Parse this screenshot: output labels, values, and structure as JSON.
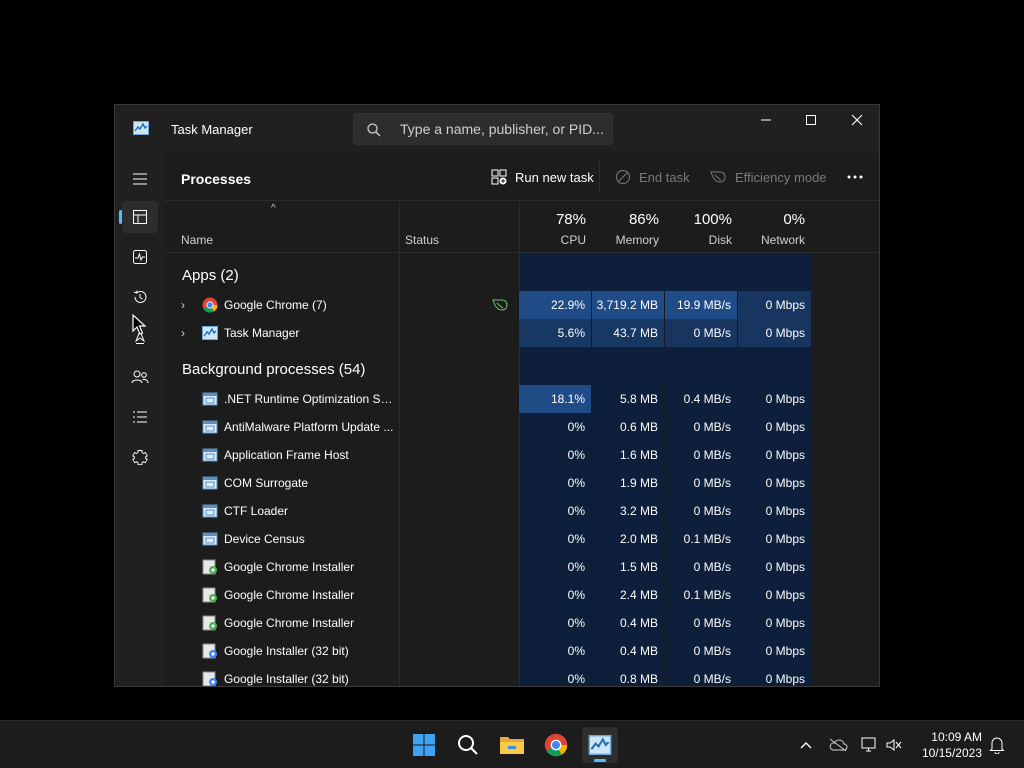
{
  "window": {
    "title": "Task Manager",
    "search_placeholder": "Type a name, publisher, or PID..."
  },
  "toolbar": {
    "page_title": "Processes",
    "run_new_task": "Run new task",
    "end_task": "End task",
    "efficiency_mode": "Efficiency mode"
  },
  "rail": {
    "items": [
      {
        "icon": "hamburger-menu-icon"
      },
      {
        "icon": "processes-icon",
        "active": true
      },
      {
        "icon": "performance-icon"
      },
      {
        "icon": "app-history-icon"
      },
      {
        "icon": "startup-apps-icon"
      },
      {
        "icon": "users-icon"
      },
      {
        "icon": "details-icon"
      },
      {
        "icon": "services-icon"
      },
      {
        "icon": "settings-icon"
      }
    ]
  },
  "columns": {
    "name": "Name",
    "status": "Status",
    "cpu": {
      "pct": "78%",
      "label": "CPU"
    },
    "memory": {
      "pct": "86%",
      "label": "Memory"
    },
    "disk": {
      "pct": "100%",
      "label": "Disk"
    },
    "network": {
      "pct": "0%",
      "label": "Network"
    }
  },
  "groups": {
    "apps": "Apps (2)",
    "background": "Background processes (54)"
  },
  "apps": [
    {
      "name": "Google Chrome (7)",
      "icon": "chrome-icon",
      "efficiency": true,
      "cpu": "22.9%",
      "memory": "3,719.2 MB",
      "disk": "19.9 MB/s",
      "network": "0 Mbps"
    },
    {
      "name": "Task Manager",
      "icon": "task-manager-icon",
      "efficiency": false,
      "cpu": "5.6%",
      "memory": "43.7 MB",
      "disk": "0 MB/s",
      "network": "0 Mbps"
    }
  ],
  "background": [
    {
      "name": ".NET Runtime Optimization Se...",
      "icon": "process-icon",
      "cpu": "18.1%",
      "memory": "5.8 MB",
      "disk": "0.4 MB/s",
      "network": "0 Mbps"
    },
    {
      "name": "AntiMalware Platform Update ...",
      "icon": "process-icon",
      "cpu": "0%",
      "memory": "0.6 MB",
      "disk": "0 MB/s",
      "network": "0 Mbps"
    },
    {
      "name": "Application Frame Host",
      "icon": "process-icon",
      "cpu": "0%",
      "memory": "1.6 MB",
      "disk": "0 MB/s",
      "network": "0 Mbps"
    },
    {
      "name": "COM Surrogate",
      "icon": "process-icon",
      "cpu": "0%",
      "memory": "1.9 MB",
      "disk": "0 MB/s",
      "network": "0 Mbps"
    },
    {
      "name": "CTF Loader",
      "icon": "process-icon",
      "cpu": "0%",
      "memory": "3.2 MB",
      "disk": "0 MB/s",
      "network": "0 Mbps"
    },
    {
      "name": "Device Census",
      "icon": "process-icon",
      "cpu": "0%",
      "memory": "2.0 MB",
      "disk": "0.1 MB/s",
      "network": "0 Mbps"
    },
    {
      "name": "Google Chrome Installer",
      "icon": "installer-icon",
      "cpu": "0%",
      "memory": "1.5 MB",
      "disk": "0 MB/s",
      "network": "0 Mbps"
    },
    {
      "name": "Google Chrome Installer",
      "icon": "installer-icon",
      "cpu": "0%",
      "memory": "2.4 MB",
      "disk": "0.1 MB/s",
      "network": "0 Mbps"
    },
    {
      "name": "Google Chrome Installer",
      "icon": "installer-icon",
      "cpu": "0%",
      "memory": "0.4 MB",
      "disk": "0 MB/s",
      "network": "0 Mbps"
    },
    {
      "name": "Google Installer (32 bit)",
      "icon": "installer-icon",
      "cpu": "0%",
      "memory": "0.4 MB",
      "disk": "0 MB/s",
      "network": "0 Mbps"
    },
    {
      "name": "Google Installer (32 bit)",
      "icon": "installer-icon",
      "cpu": "0%",
      "memory": "0.8 MB",
      "disk": "0 MB/s",
      "network": "0 Mbps"
    }
  ],
  "taskbar": {
    "apps": [
      "start-icon",
      "search-icon",
      "file-explorer-icon",
      "chrome-icon",
      "task-manager-icon"
    ],
    "time": "10:09 AM",
    "date": "10/15/2023"
  },
  "colors": {
    "accent": "#4cc2ff",
    "heat_high": "#1f4b87",
    "heat_mid": "#163863",
    "heat_base": "#0d1f3a"
  }
}
